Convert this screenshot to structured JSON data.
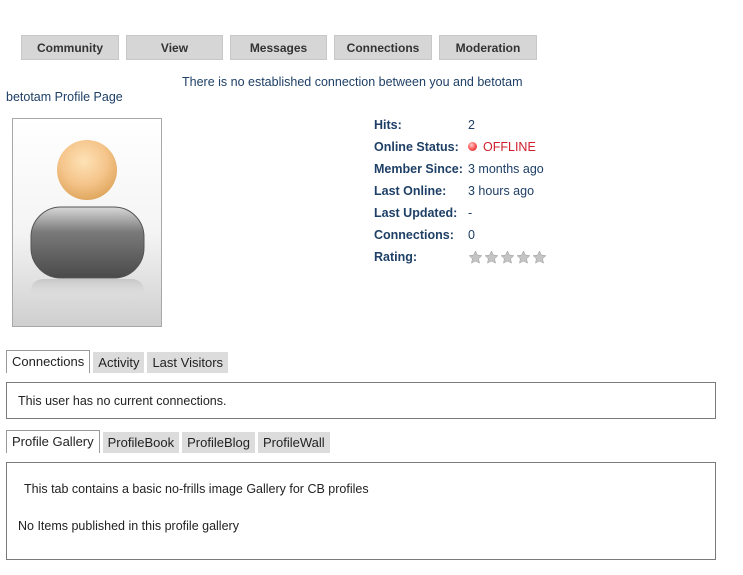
{
  "nav": {
    "items": [
      {
        "label": "Community"
      },
      {
        "label": "View"
      },
      {
        "label": "Messages"
      },
      {
        "label": "Connections"
      },
      {
        "label": "Moderation"
      }
    ]
  },
  "notice": "There is no established connection between you and betotam",
  "profile_title": "betotam Profile Page",
  "details": {
    "hits": {
      "label": "Hits:",
      "value": "2"
    },
    "online_status": {
      "label": "Online Status:",
      "value": "OFFLINE"
    },
    "member_since": {
      "label": "Member Since:",
      "value": "3 months ago"
    },
    "last_online": {
      "label": "Last Online:",
      "value": "3 hours ago"
    },
    "last_updated": {
      "label": "Last Updated:",
      "value": "-"
    },
    "connections": {
      "label": "Connections:",
      "value": "0"
    },
    "rating": {
      "label": "Rating:",
      "value": 0,
      "max": 5
    }
  },
  "tabs_top": {
    "items": [
      {
        "label": "Connections"
      },
      {
        "label": "Activity"
      },
      {
        "label": "Last Visitors"
      }
    ],
    "active_index": 0,
    "panel_text": "This user has no current connections."
  },
  "tabs_bottom": {
    "items": [
      {
        "label": "Profile Gallery"
      },
      {
        "label": "ProfileBook"
      },
      {
        "label": "ProfileBlog"
      },
      {
        "label": "ProfileWall"
      }
    ],
    "active_index": 0,
    "gallery_intro": "This tab contains a basic no-frills image Gallery for CB profiles",
    "gallery_empty": "No Items published in this profile gallery"
  },
  "colors": {
    "label_blue": "#1e3f66",
    "offline_red": "#d0202c",
    "tab_gray": "#dcdcdc",
    "nav_gray": "#d6d6d6"
  }
}
